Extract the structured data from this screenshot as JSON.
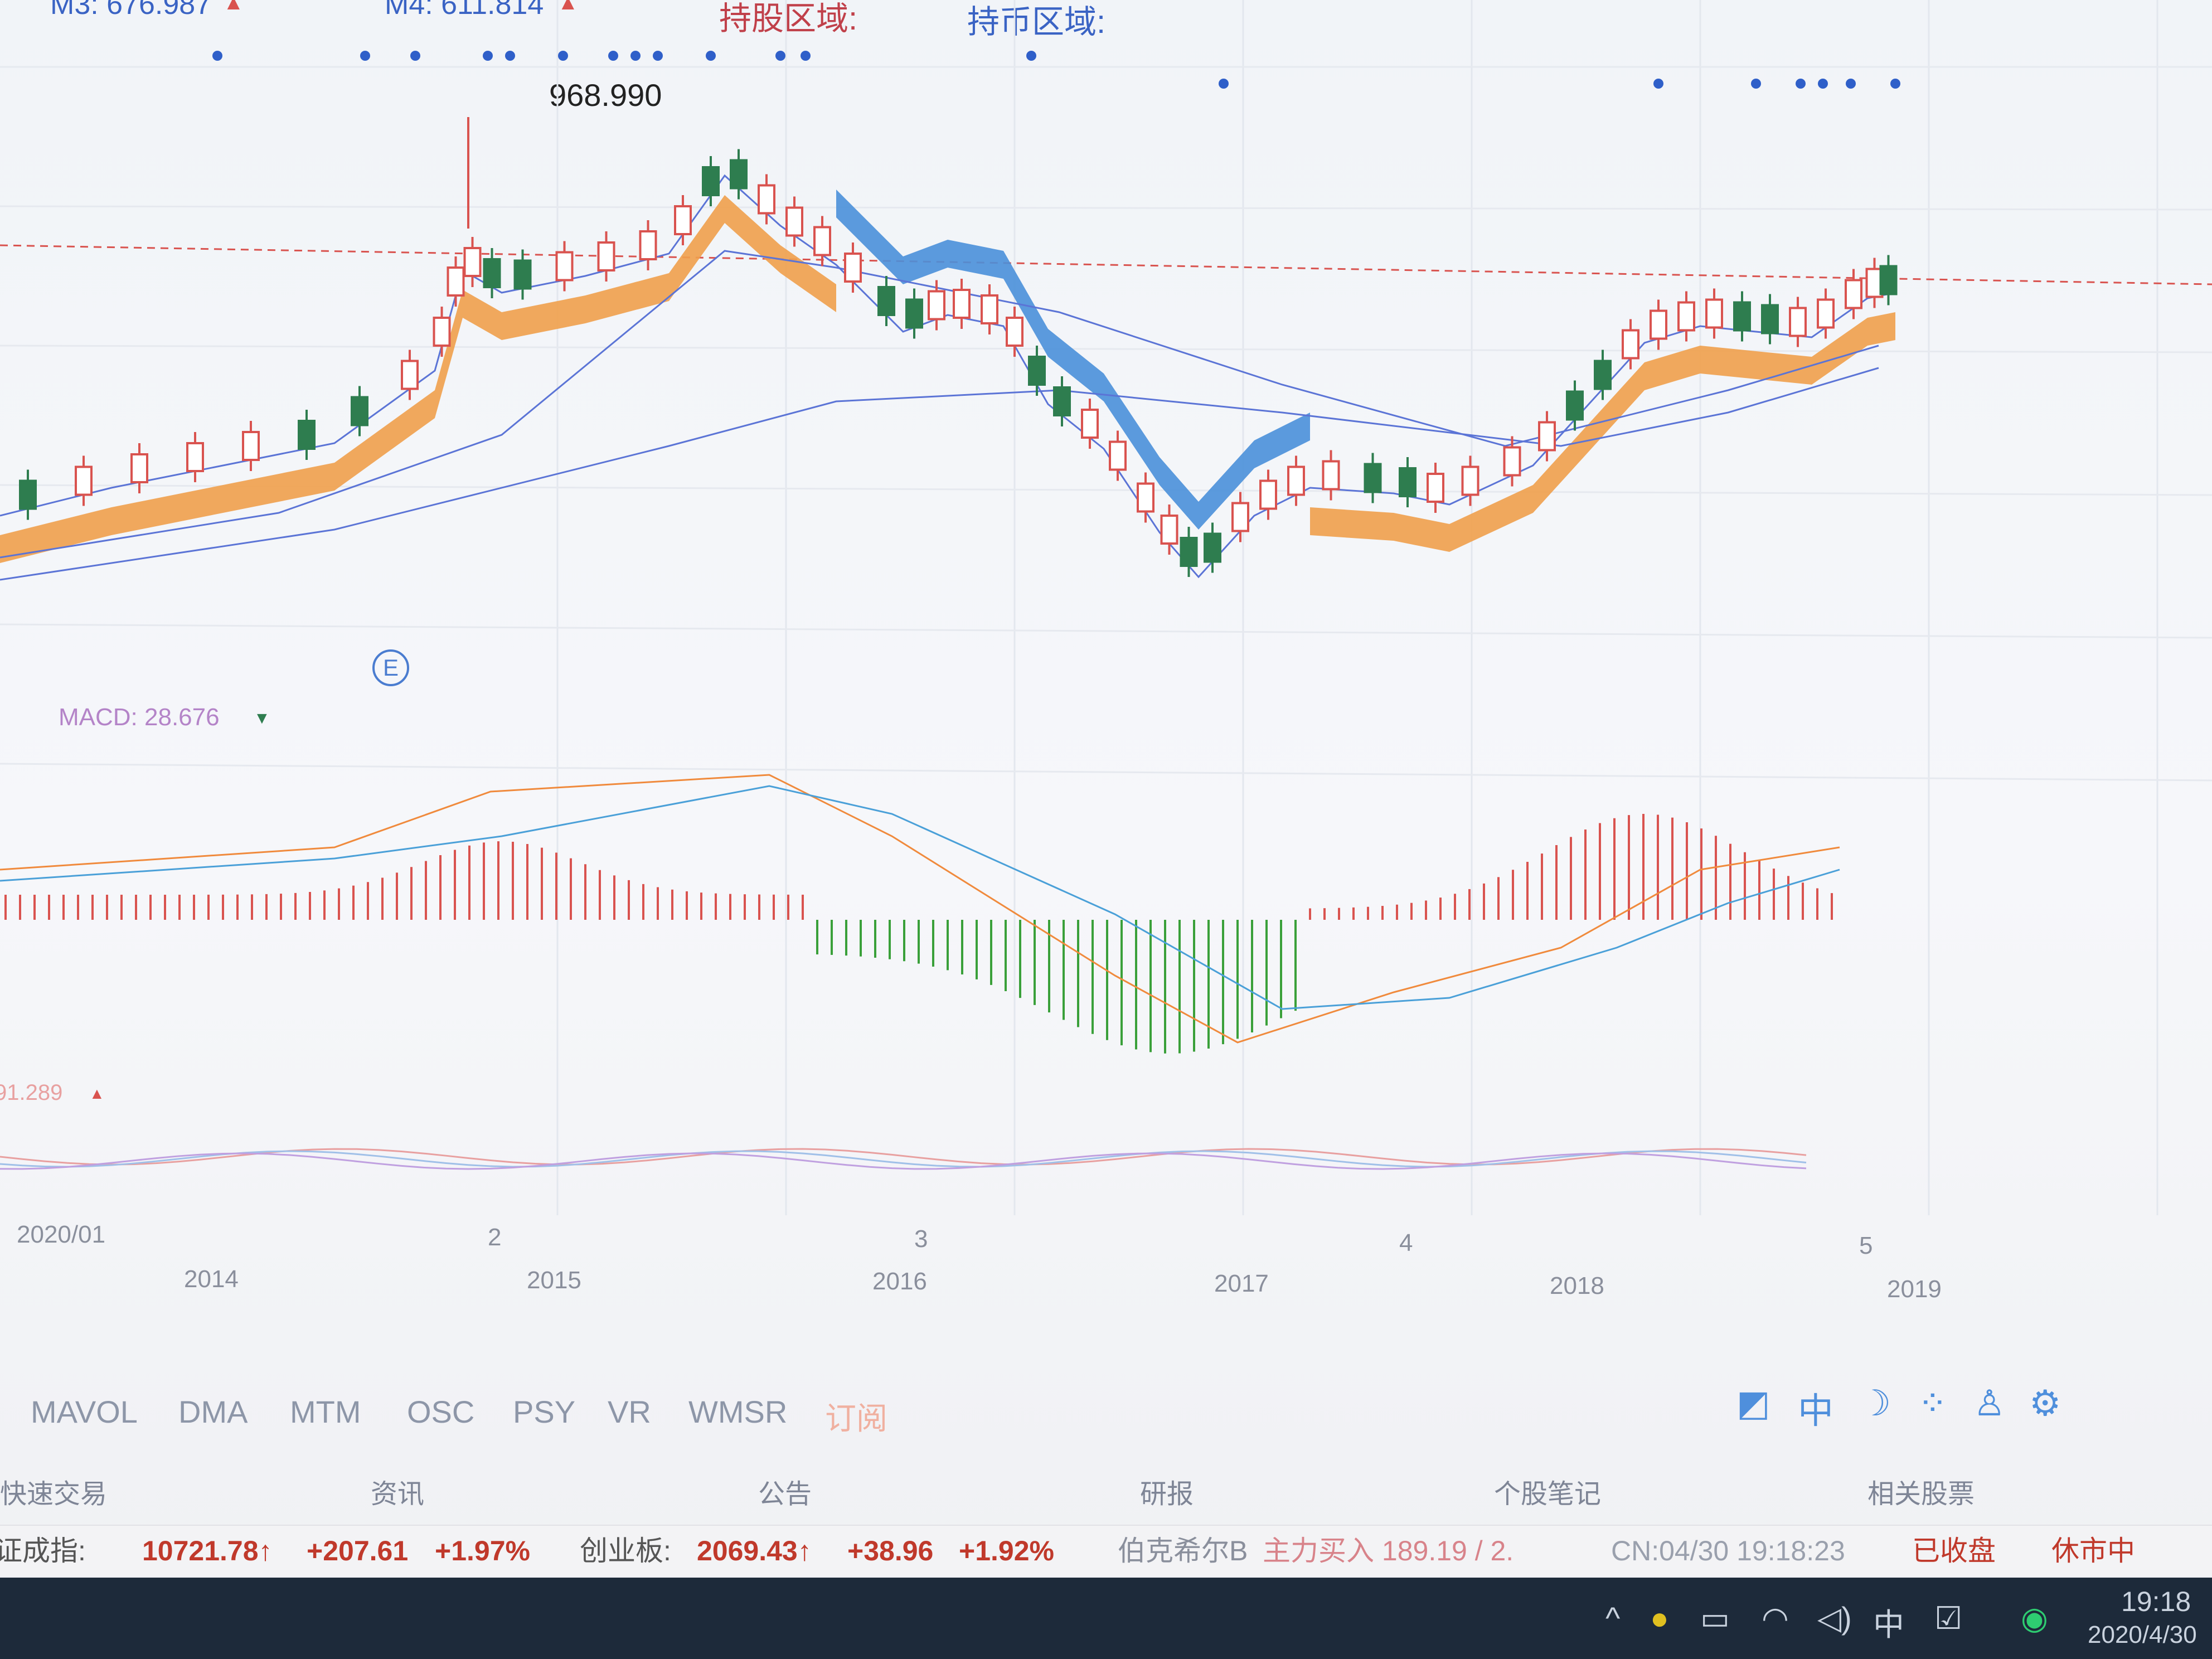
{
  "indicators": {
    "m3": "M3: 676.987",
    "m4": "M4: 611.814",
    "hold_stock": "持股区域:",
    "hold_cash": "持币区域:",
    "m3_arrow": "▲",
    "m4_arrow": "▲"
  },
  "price_high_label": "968.990",
  "macd_label": "MACD: 28.676",
  "macd_arrow": "▼",
  "osc_label": "91.289",
  "osc_arrow": "▲",
  "marker_e": "E",
  "period_labels": [
    {
      "text": "2020/01"
    },
    {
      "text": "2"
    },
    {
      "text": "3"
    },
    {
      "text": "4"
    },
    {
      "text": "5"
    }
  ],
  "year_labels": [
    "2014",
    "2015",
    "2016",
    "2017",
    "2018",
    "2019"
  ],
  "indicator_tabs": [
    "MAVOL",
    "DMA",
    "MTM",
    "OSC",
    "PSY",
    "VR",
    "WMSR",
    "订阅"
  ],
  "bottom_tabs": [
    "快速交易",
    "资讯",
    "公告",
    "研报",
    "个股笔记",
    "相关股票"
  ],
  "ticker": {
    "index_name": "深证成指:",
    "index_value": "10721.78↑",
    "index_change": "+207.61",
    "index_pct": "+1.97%",
    "gem_name": "创业板:",
    "gem_value": "2069.43↑",
    "gem_change": "+38.96",
    "gem_pct": "+1.92%",
    "stock_name": "伯克希尔B",
    "flow_text": "主力买入 189.19 / 2.",
    "cn_time": "CN:04/30 19:18:23",
    "closed": "已收盘",
    "rest": "休市中"
  },
  "toolbar_icons": [
    "chart-icon",
    "chinese-input-icon",
    "moon-icon",
    "dots-icon",
    "user-icon",
    "gear-icon"
  ],
  "toolbar_glyphs": [
    "◩",
    "中",
    "☽",
    "⁘",
    "♙",
    "⚙"
  ],
  "taskbar": {
    "clock_time": "19:18",
    "clock_date": "2020/4/30",
    "ime": "中",
    "chevron": "^"
  },
  "colors": {
    "up": "#d9534f",
    "down": "#2e7d4f",
    "orange_band": "#f0a04b",
    "blue_band": "#4a90d9",
    "ma_line": "#5b74d6",
    "dif": "#f08a3c",
    "dea": "#4aa0d8",
    "indicator_label": "#3a63c4"
  },
  "chart_data": {
    "type": "candlestick",
    "y_marker": 968.99,
    "candles_visible": true
  }
}
